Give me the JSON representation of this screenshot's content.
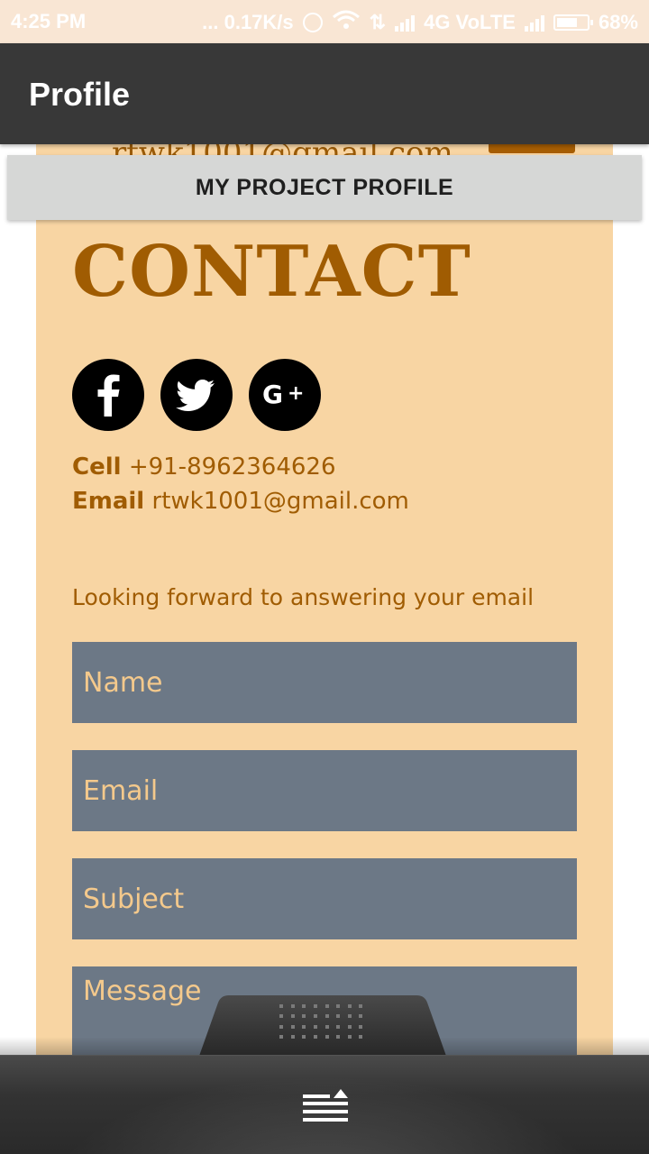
{
  "status_bar": {
    "time": "4:25 PM",
    "speed": "... 0.17K/s",
    "network": "4G VoLTE",
    "battery": "68%",
    "icons": [
      "alarm-icon",
      "wifi-icon",
      "data-arrows-icon",
      "signal-icon",
      "signal-icon",
      "battery-icon"
    ]
  },
  "app_bar": {
    "title": "Profile"
  },
  "header_peek": {
    "email": "rtwk1001@gmail.com"
  },
  "project_bar": {
    "label": "MY PROJECT PROFILE"
  },
  "contact": {
    "heading": "CONTACT",
    "social": [
      {
        "name": "facebook-icon",
        "glyph": "f"
      },
      {
        "name": "twitter-icon",
        "glyph": "bird"
      },
      {
        "name": "google-plus-icon",
        "glyph": "G+"
      }
    ],
    "cell_label": "Cell",
    "cell_value": "+91-8962364626",
    "email_label": "Email",
    "email_value": "rtwk1001@gmail.com",
    "tagline": "Looking forward to answering your email"
  },
  "form": {
    "name_placeholder": "Name",
    "email_placeholder": "Email",
    "subject_placeholder": "Subject",
    "message_placeholder": "Message"
  },
  "dock": {
    "menu_icon": "menu-expand-icon"
  },
  "colors": {
    "accent": "#a05c02",
    "card_background": "#f8d5a3",
    "field_background": "#6c7886",
    "field_text": "#f4c98c",
    "app_bar": "#383838"
  }
}
